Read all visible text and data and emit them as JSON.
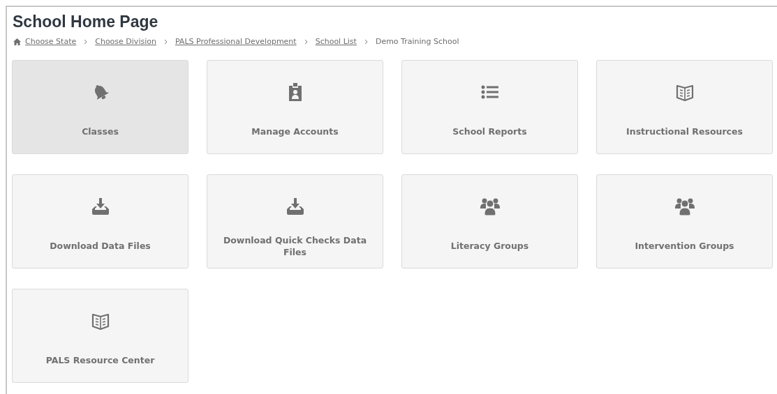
{
  "page": {
    "title": "School Home Page"
  },
  "breadcrumb": [
    {
      "label": "Choose State",
      "kind": "link"
    },
    {
      "label": "Choose Division",
      "kind": "link"
    },
    {
      "label": "PALS Professional Development",
      "kind": "link"
    },
    {
      "label": "School List",
      "kind": "link"
    },
    {
      "label": "Demo Training School",
      "kind": "current"
    }
  ],
  "tiles": [
    {
      "label": "Classes",
      "kind": "bell",
      "selected": true
    },
    {
      "label": "Manage Accounts",
      "kind": "badge",
      "selected": false
    },
    {
      "label": "School Reports",
      "kind": "list",
      "selected": false
    },
    {
      "label": "Instructional Resources",
      "kind": "book",
      "selected": false
    },
    {
      "label": "Download Data Files",
      "kind": "download",
      "selected": false
    },
    {
      "label": "Download Quick Checks Data Files",
      "kind": "download",
      "selected": false
    },
    {
      "label": "Literacy Groups",
      "kind": "users",
      "selected": false
    },
    {
      "label": "Intervention Groups",
      "kind": "users",
      "selected": false
    },
    {
      "label": "PALS Resource Center",
      "kind": "book",
      "selected": false
    }
  ]
}
